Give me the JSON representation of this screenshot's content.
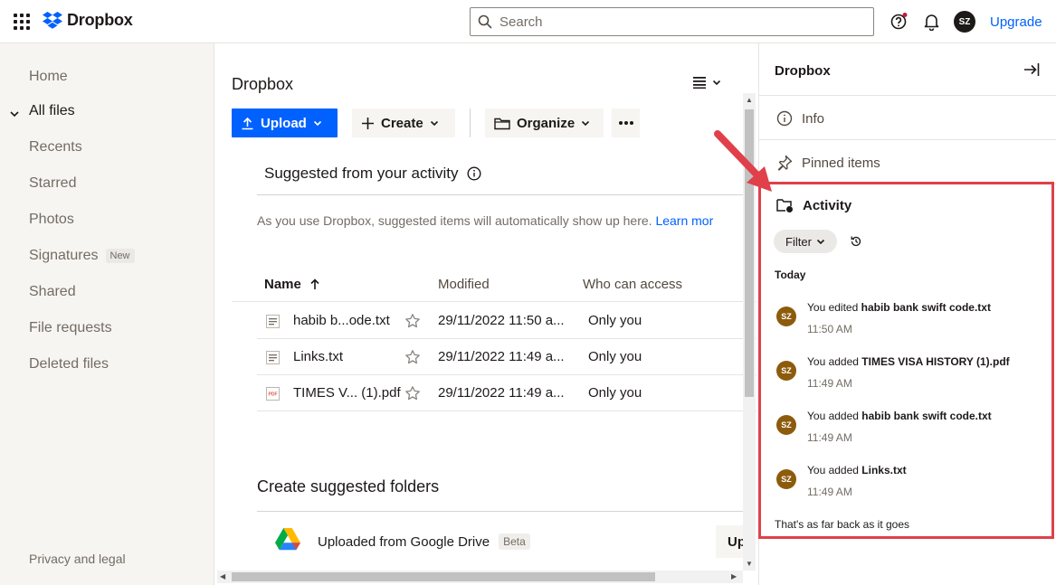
{
  "header": {
    "logo_text": "Dropbox",
    "search_placeholder": "Search",
    "avatar_initials": "SZ",
    "upgrade_label": "Upgrade"
  },
  "sidebar": {
    "items": [
      {
        "label": "Home"
      },
      {
        "label": "All files"
      },
      {
        "label": "Recents"
      },
      {
        "label": "Starred"
      },
      {
        "label": "Photos"
      },
      {
        "label": "Signatures",
        "badge": "New"
      },
      {
        "label": "Shared"
      },
      {
        "label": "File requests"
      },
      {
        "label": "Deleted files"
      }
    ],
    "privacy_label": "Privacy and legal"
  },
  "main": {
    "title": "Dropbox",
    "toolbar": {
      "upload_label": "Upload",
      "create_label": "Create",
      "organize_label": "Organize"
    },
    "suggested": {
      "title": "Suggested from your activity",
      "description": "As you use Dropbox, suggested items will automatically show up here.",
      "learn_more": "Learn mor"
    },
    "table": {
      "headers": {
        "name": "Name",
        "modified": "Modified",
        "access": "Who can access"
      },
      "rows": [
        {
          "name": "habib b...ode.txt",
          "modified": "29/11/2022 11:50 a...",
          "access": "Only you",
          "type": "txt"
        },
        {
          "name": "Links.txt",
          "modified": "29/11/2022 11:49 a...",
          "access": "Only you",
          "type": "txt"
        },
        {
          "name": "TIMES V... (1).pdf",
          "modified": "29/11/2022 11:49 a...",
          "access": "Only you",
          "type": "pdf"
        }
      ]
    },
    "suggested_folders": {
      "title": "Create suggested folders",
      "item_label": "Uploaded from Google Drive",
      "item_badge": "Beta",
      "item_button": "Up"
    }
  },
  "panel": {
    "title": "Dropbox",
    "info_label": "Info",
    "pinned_label": "Pinned items",
    "activity_label": "Activity",
    "filter_label": "Filter",
    "today_label": "Today",
    "activities": [
      {
        "initials": "SZ",
        "action": "You edited",
        "file": "habib bank swift code.txt",
        "time": "11:50 AM"
      },
      {
        "initials": "SZ",
        "action": "You added",
        "file": "TIMES VISA HISTORY (1).pdf",
        "time": "11:49 AM"
      },
      {
        "initials": "SZ",
        "action": "You added",
        "file": "habib bank swift code.txt",
        "time": "11:49 AM"
      },
      {
        "initials": "SZ",
        "action": "You added",
        "file": "Links.txt",
        "time": "11:49 AM"
      }
    ],
    "end_message": "That's as far back as it goes"
  },
  "colors": {
    "accent": "#0061fe",
    "highlight": "#e0404a",
    "avatar_activity": "#8c5b0c"
  }
}
